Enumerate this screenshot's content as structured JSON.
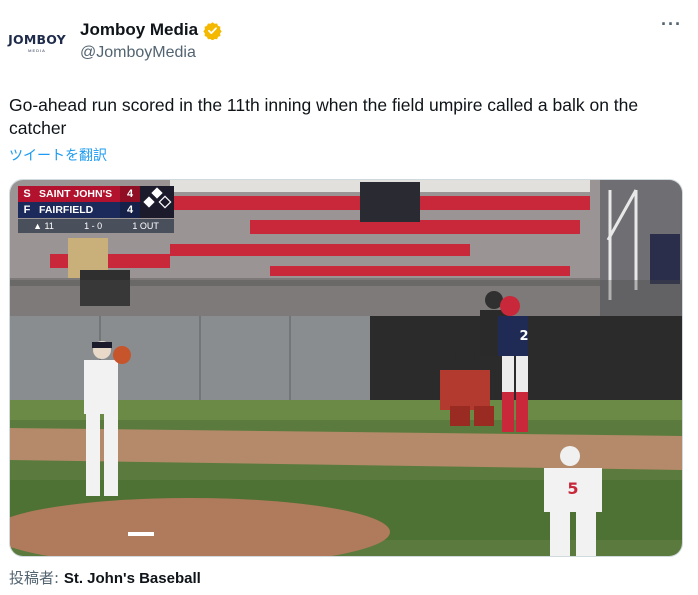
{
  "author": {
    "avatar_text": "JOMBOY",
    "avatar_subtext": "MEDIA",
    "name": "Jomboy Media",
    "handle": "@JomboyMedia",
    "verified_icon": "verified-badge-icon",
    "verified_color": "#f5b800"
  },
  "more_label": "···",
  "tweet": {
    "text": "Go-ahead run scored in the 11th inning when the field umpire called a balk on the catcher",
    "translate_label": "ツイートを翻訳"
  },
  "media": {
    "scoreboard": {
      "team1": {
        "logo": "S",
        "name": "SAINT JOHN'S",
        "score": "4"
      },
      "team2": {
        "logo": "F",
        "name": "FAIRFIELD",
        "score": "4"
      },
      "inning": "▲ 11",
      "count": "1 - 0",
      "outs": "1 OUT"
    },
    "jersey_batter": "2",
    "jersey_fielder": "5"
  },
  "footer": {
    "prefix": "投稿者:",
    "source": "St. John's Baseball"
  },
  "colors": {
    "link": "#1d9bf0",
    "secondary_text": "#536471",
    "saint_johns_red": "#b3122e",
    "fairfield_blue": "#1b2a5a"
  }
}
